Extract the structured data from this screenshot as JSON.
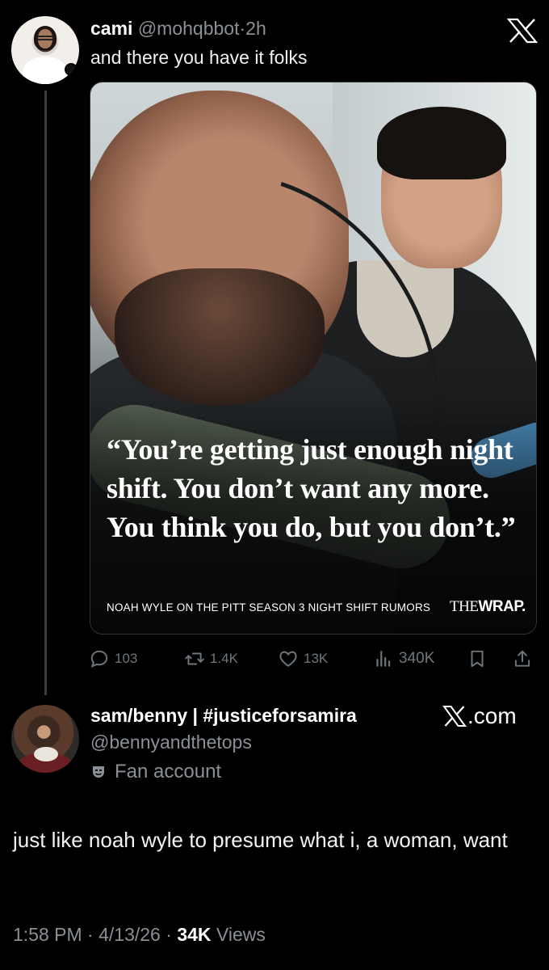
{
  "quoted_tweet": {
    "name": "cami",
    "handle": "@mohqbbot",
    "separator": "·",
    "time": "2h",
    "text": "and there you have it folks",
    "image": {
      "quote": "“You’re getting just enough night shift. You don’t want any more. You think you do, but you don’t.”",
      "caption": "NOAH WYLE ON THE PITT SEASON 3 NIGHT SHIFT RUMORS",
      "logo_the": "THE",
      "logo_wrap": "WRAP."
    },
    "actions": {
      "replies": "103",
      "reposts": "1.4K",
      "likes": "13K",
      "views": "340K"
    }
  },
  "main_tweet": {
    "name": "sam/benny | #justiceforsamira",
    "handle": "@bennyandthetops",
    "label": "Fan account",
    "source": ".com",
    "text": "just like noah wyle to presume what i, a woman, want",
    "time": "1:58 PM",
    "date": "4/13/26",
    "separator": "·",
    "views_count": "34K",
    "views_label": "Views"
  },
  "icons": {
    "top_right": "x-logo-icon",
    "reply": "reply-icon",
    "repost": "repost-icon",
    "like": "heart-icon",
    "views": "views-bar-icon",
    "bookmark": "bookmark-icon",
    "share": "share-icon",
    "fan_badge": "theater-mask-icon"
  },
  "colors": {
    "background": "#000000",
    "text_primary": "#e7e9ea",
    "text_secondary": "#8b9096",
    "thread_line": "#3b3e42"
  }
}
